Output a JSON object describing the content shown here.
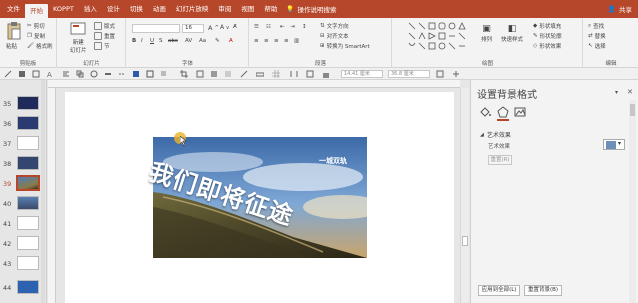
{
  "tabs": [
    "文件",
    "开始",
    "KOPPT",
    "插入",
    "设计",
    "切换",
    "动画",
    "幻灯片放映",
    "审阅",
    "视图",
    "帮助"
  ],
  "active_tab_index": 1,
  "tell_me": "操作说明搜索",
  "share": "共享",
  "ribbon": {
    "clipboard": {
      "paste": "粘贴",
      "cut": "剪切",
      "copy": "复制",
      "format_painter": "格式刷",
      "label": "剪贴板"
    },
    "slides": {
      "new_slide_l1": "新建",
      "new_slide_l2": "幻灯片",
      "layout": "版式",
      "reset": "重置",
      "section": "节",
      "label": "幻灯片"
    },
    "font": {
      "size": "16",
      "label": "字体"
    },
    "paragraph": {
      "text_direction": "文字方向",
      "align_text": "对齐文本",
      "smartart": "转换为 SmartArt",
      "label": "段落"
    },
    "drawing": {
      "arrange": "排列",
      "quick_styles": "快速样式",
      "shape_fill": "形状填充",
      "shape_outline": "形状轮廓",
      "shape_effects": "形状效果",
      "label": "绘图"
    },
    "editing": {
      "find": "查找",
      "replace": "替换",
      "select": "选择",
      "label": "编辑"
    }
  },
  "toolbar2": {
    "width": "14.41 厘米",
    "height": "36.8 厘米"
  },
  "thumbnails": [
    {
      "num": "35",
      "selected": false
    },
    {
      "num": "36",
      "selected": false
    },
    {
      "num": "37",
      "selected": false
    },
    {
      "num": "38",
      "selected": false
    },
    {
      "num": "39",
      "selected": true
    },
    {
      "num": "40",
      "selected": false
    },
    {
      "num": "41",
      "selected": false
    },
    {
      "num": "42",
      "selected": false
    },
    {
      "num": "43",
      "selected": false
    },
    {
      "num": "44",
      "selected": false
    }
  ],
  "slide": {
    "title": "我们即将征途",
    "subtitle": "一城双轨"
  },
  "pane": {
    "title": "设置背景格式",
    "section": "艺术效果",
    "effect_label": "艺术效果",
    "reset": "重置(R)",
    "apply_all": "应用到全部(L)",
    "reset_bg": "重置背景(B)"
  },
  "colors": {
    "accent": "#b7472a"
  }
}
